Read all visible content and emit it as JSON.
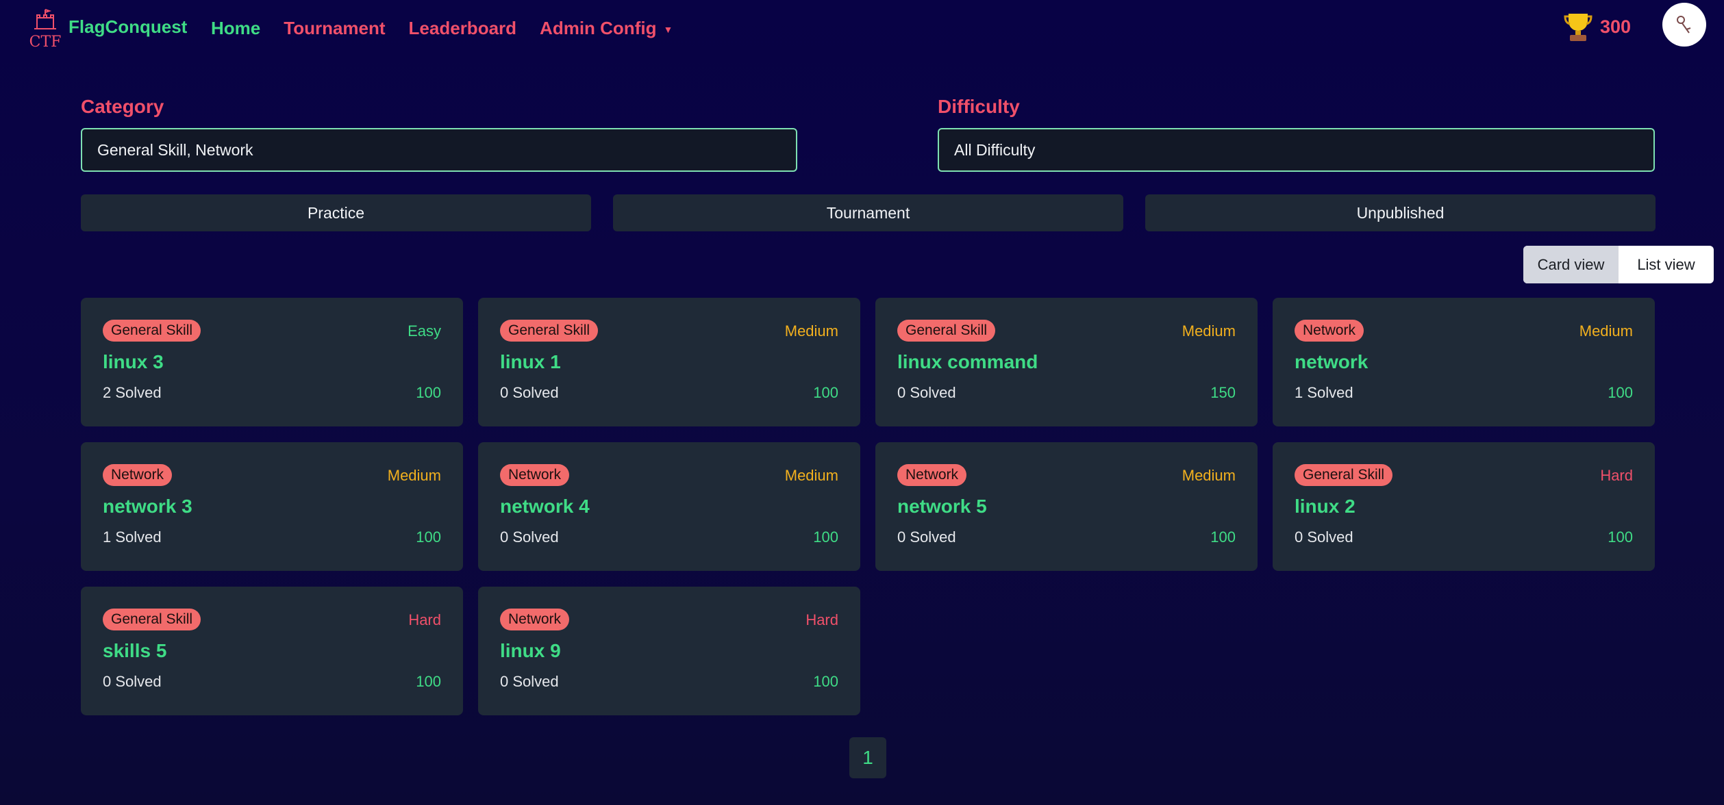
{
  "nav": {
    "logo_text": "CTF",
    "brand": "FlagConquest",
    "links": [
      {
        "label": "Home",
        "active": true
      },
      {
        "label": "Tournament",
        "active": false
      },
      {
        "label": "Leaderboard",
        "active": false
      },
      {
        "label": "Admin Config",
        "active": false,
        "dropdown": true
      }
    ],
    "score": "300",
    "score_icon": "trophy-icon",
    "avatar_icon": "user-avatar-icon"
  },
  "filters": {
    "category_label": "Category",
    "category_value": "General Skill, Network",
    "difficulty_label": "Difficulty",
    "difficulty_value": "All Difficulty"
  },
  "modes": [
    "Practice",
    "Tournament",
    "Unpublished"
  ],
  "view_toggle": {
    "card_label": "Card view",
    "list_label": "List view",
    "selected": "Card view"
  },
  "challenges": [
    {
      "category": "General Skill",
      "difficulty": "Easy",
      "title": "linux 3",
      "solved": "2 Solved",
      "points": "100"
    },
    {
      "category": "General Skill",
      "difficulty": "Medium",
      "title": "linux 1",
      "solved": "0 Solved",
      "points": "100"
    },
    {
      "category": "General Skill",
      "difficulty": "Medium",
      "title": "linux command",
      "solved": "0 Solved",
      "points": "150"
    },
    {
      "category": "Network",
      "difficulty": "Medium",
      "title": "network",
      "solved": "1 Solved",
      "points": "100"
    },
    {
      "category": "Network",
      "difficulty": "Medium",
      "title": "network 3",
      "solved": "1 Solved",
      "points": "100"
    },
    {
      "category": "Network",
      "difficulty": "Medium",
      "title": "network 4",
      "solved": "0 Solved",
      "points": "100"
    },
    {
      "category": "Network",
      "difficulty": "Medium",
      "title": "network 5",
      "solved": "0 Solved",
      "points": "100"
    },
    {
      "category": "General Skill",
      "difficulty": "Hard",
      "title": "linux 2",
      "solved": "0 Solved",
      "points": "100"
    },
    {
      "category": "General Skill",
      "difficulty": "Hard",
      "title": "skills 5",
      "solved": "0 Solved",
      "points": "100"
    },
    {
      "category": "Network",
      "difficulty": "Hard",
      "title": "linux 9",
      "solved": "0 Solved",
      "points": "100"
    }
  ],
  "pagination": {
    "current": "1"
  },
  "colors": {
    "accent_green": "#3fdc86",
    "accent_red": "#f0506a",
    "medium_orange": "#f2b01e",
    "tag_bg": "#f26b6b",
    "card_bg": "#1f2a37"
  }
}
